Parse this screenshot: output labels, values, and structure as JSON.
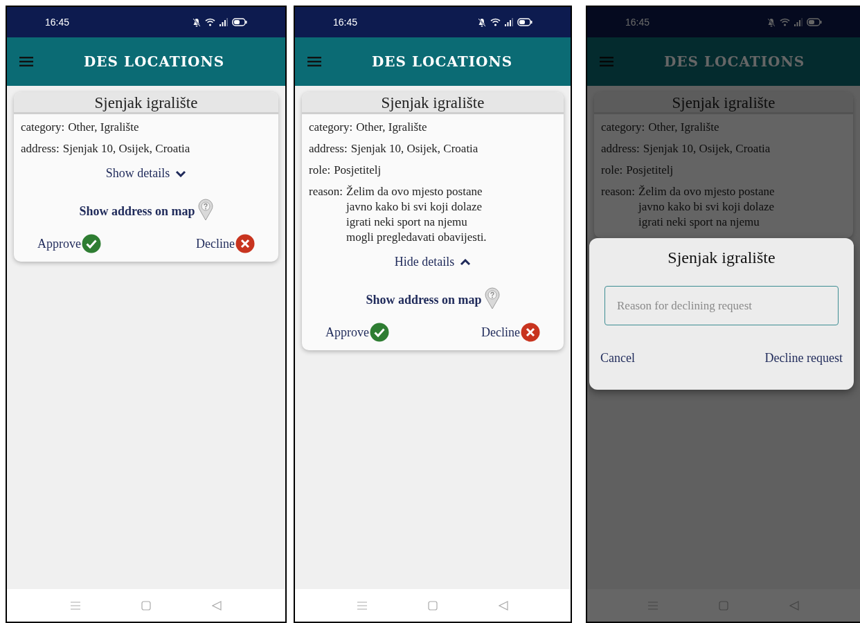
{
  "screens": [
    {
      "status_time": "16:45",
      "app_title": "DES LOCATIONS",
      "card": {
        "title": "Sjenjak igralište",
        "fields": [
          {
            "label": "category:",
            "lines": [
              "Other, Igralište"
            ]
          },
          {
            "label": "address:",
            "lines": [
              "Sjenjak 10, Osijek, Croatia"
            ]
          }
        ],
        "details_toggle": {
          "label": "Show details",
          "expanded": false
        },
        "map_link": "Show address on map",
        "approve": "Approve",
        "decline": "Decline"
      }
    },
    {
      "status_time": "16:45",
      "app_title": "DES LOCATIONS",
      "card": {
        "title": "Sjenjak igralište",
        "fields": [
          {
            "label": "category:",
            "lines": [
              "Other, Igralište"
            ]
          },
          {
            "label": "address:",
            "lines": [
              "Sjenjak 10, Osijek, Croatia"
            ]
          },
          {
            "label": "role:",
            "lines": [
              "Posjetitelj"
            ]
          },
          {
            "label": "reason:",
            "lines": [
              "Želim da ovo mjesto postane",
              "javno kako bi svi koji dolaze",
              "igrati neki sport na njemu",
              "mogli pregledavati obavijesti."
            ]
          }
        ],
        "details_toggle": {
          "label": "Hide details",
          "expanded": true
        },
        "map_link": "Show address on map",
        "approve": "Approve",
        "decline": "Decline"
      }
    },
    {
      "status_time": "16:45",
      "app_title": "DES LOCATIONS",
      "card": {
        "title": "Sjenjak igralište",
        "fields": [
          {
            "label": "category:",
            "lines": [
              "Other, Igralište"
            ]
          },
          {
            "label": "address:",
            "lines": [
              "Sjenjak 10, Osijek, Croatia"
            ]
          },
          {
            "label": "role:",
            "lines": [
              "Posjetitelj"
            ]
          },
          {
            "label": "reason:",
            "lines": [
              "Želim da ovo mjesto postane",
              "javno kako bi svi koji dolaze",
              "igrati neki sport na njemu"
            ]
          }
        ]
      },
      "dialog": {
        "title": "Sjenjak igralište",
        "placeholder": "Reason for declining request",
        "buttons": [
          "Cancel",
          "Decline request"
        ]
      }
    }
  ]
}
